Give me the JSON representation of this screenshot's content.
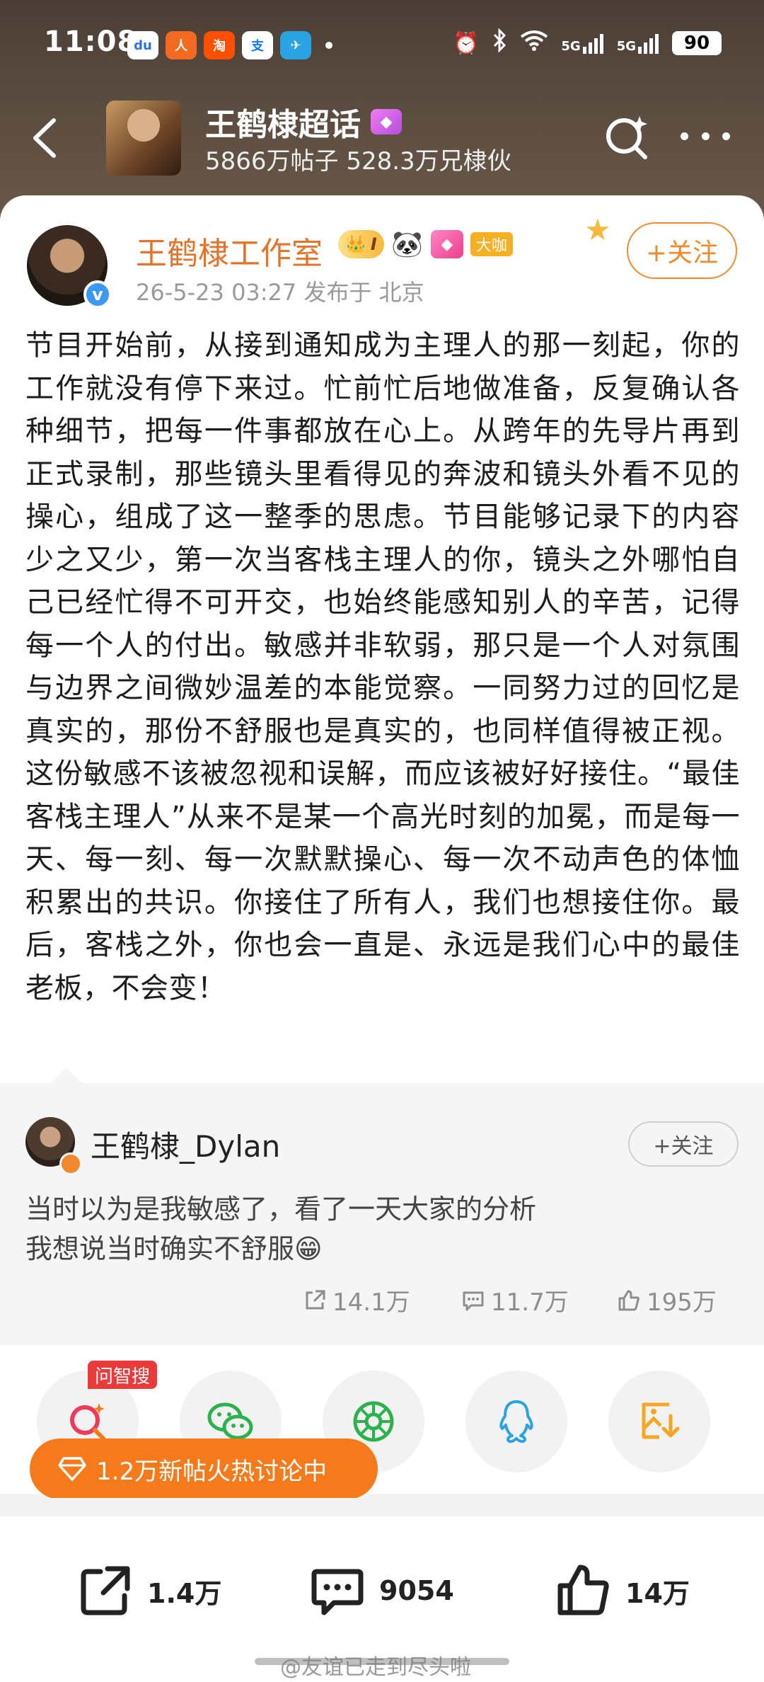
{
  "status_bar": {
    "time": "11:08",
    "apps": [
      {
        "icon": "baidu-icon",
        "label": "du",
        "color": "#2c6de8"
      },
      {
        "icon": "app-orange-icon",
        "label": "人",
        "color": "#f26b21"
      },
      {
        "icon": "taobao-flash-icon",
        "label": "淘",
        "color": "#ff5000"
      },
      {
        "icon": "alipay-icon",
        "label": "支",
        "color": "#1677ff"
      },
      {
        "icon": "telegram-icon",
        "label": "✈",
        "color": "#2aa3e0"
      }
    ],
    "network": "5G",
    "battery": "90"
  },
  "topic": {
    "title": "王鹤棣超话",
    "stats": "5866万帖子 528.3万兄棣伙"
  },
  "post": {
    "author": "王鹤棣工作室",
    "vip_level": "I",
    "big_badge": "大咖",
    "meta": "26-5-23 03:27  发布于 北京",
    "follow_label": "+关注",
    "body": "节目开始前，从接到通知成为主理人的那一刻起，你的工作就没有停下来过。忙前忙后地做准备，反复确认各种细节，把每一件事都放在心上。从跨年的先导片再到正式录制，那些镜头里看得见的奔波和镜头外看不见的操心，组成了这一整季的思虑。节目能够记录下的内容少之又少，第一次当客栈主理人的你，镜头之外哪怕自己已经忙得不可开交，也始终能感知别人的辛苦，记得每一个人的付出。敏感并非软弱，那只是一个人对氛围与边界之间微妙温差的本能觉察。一同努力过的回忆是真实的，那份不舒服也是真实的，也同样值得被正视。这份敏感不该被忽视和误解，而应该被好好接住。“最佳客栈主理人”从来不是某一个高光时刻的加冕，而是每一天、每一刻、每一次默默操心、每一次不动声色的体恤积累出的共识。你接住了所有人，我们也想接住你。最后，客栈之外，你也会一直是、永远是我们心中的最佳老板，不会变！"
  },
  "repost": {
    "author": "王鹤棣_Dylan",
    "follow_label": "+关注",
    "line1": "当时以为是我敏感了，看了一天大家的分析",
    "line2": "我想说当时确实不舒服😁",
    "shares": "14.1万",
    "comments": "11.7万",
    "likes": "195万"
  },
  "share_row": {
    "wzs_tag": "问智搜",
    "hot_text": "1.2万新帖火热讨论中",
    "buttons": [
      "search-ai-icon",
      "wechat-icon",
      "moments-icon",
      "qq-icon",
      "save-image-icon"
    ]
  },
  "bottom_bar": {
    "shares": "1.4万",
    "comments": "9054",
    "likes": "14万",
    "watermark": "@友谊已走到尽头啦"
  },
  "colors": {
    "accent_orange": "#f08a2c",
    "author_orange": "#e2752b",
    "hot_pill": "#f57a1b",
    "header_brown": "#5b4c40"
  }
}
